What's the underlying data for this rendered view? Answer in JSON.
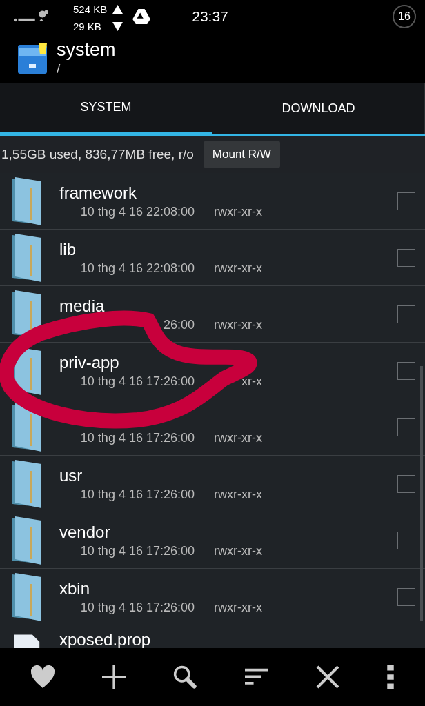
{
  "status_bar": {
    "upload": "524 KB",
    "download": "29 KB",
    "time": "23:37",
    "badge": "16"
  },
  "header": {
    "title": "system",
    "path": "/"
  },
  "tabs": [
    {
      "label": "SYSTEM",
      "selected": true
    },
    {
      "label": "DOWNLOAD",
      "selected": false
    }
  ],
  "storage": {
    "info": "1,55GB used, 836,77MB free, r/o",
    "button": "Mount R/W"
  },
  "files": [
    {
      "kind": "folder",
      "name": "framework",
      "date": "10 thg 4 16 22:08:00",
      "perms": "rwxr-xr-x",
      "checked": false
    },
    {
      "kind": "folder",
      "name": "lib",
      "date": "10 thg 4 16 22:08:00",
      "perms": "rwxr-xr-x",
      "checked": false
    },
    {
      "kind": "folder",
      "name": "media",
      "date": "26:00",
      "perms": "rwxr-xr-x",
      "checked": false
    },
    {
      "kind": "folder",
      "name": "priv-app",
      "date": "10 thg 4 16 17:26:00",
      "perms": "xr-x",
      "checked": false
    },
    {
      "kind": "folder",
      "date": "10 thg 4 16 17:26:00",
      "perms": "rwxr-xr-x",
      "checked": false
    },
    {
      "kind": "folder",
      "name": "usr",
      "date": "10 thg 4 16 17:26:00",
      "perms": "rwxr-xr-x",
      "checked": false
    },
    {
      "kind": "folder",
      "name": "vendor",
      "date": "10 thg 4 16 17:26:00",
      "perms": "rwxr-xr-x",
      "checked": false
    },
    {
      "kind": "folder",
      "name": "xbin",
      "date": "10 thg 4 16 17:26:00",
      "perms": "rwxr-xr-x",
      "checked": false
    },
    {
      "kind": "file",
      "name": "xposed.prop"
    }
  ]
}
